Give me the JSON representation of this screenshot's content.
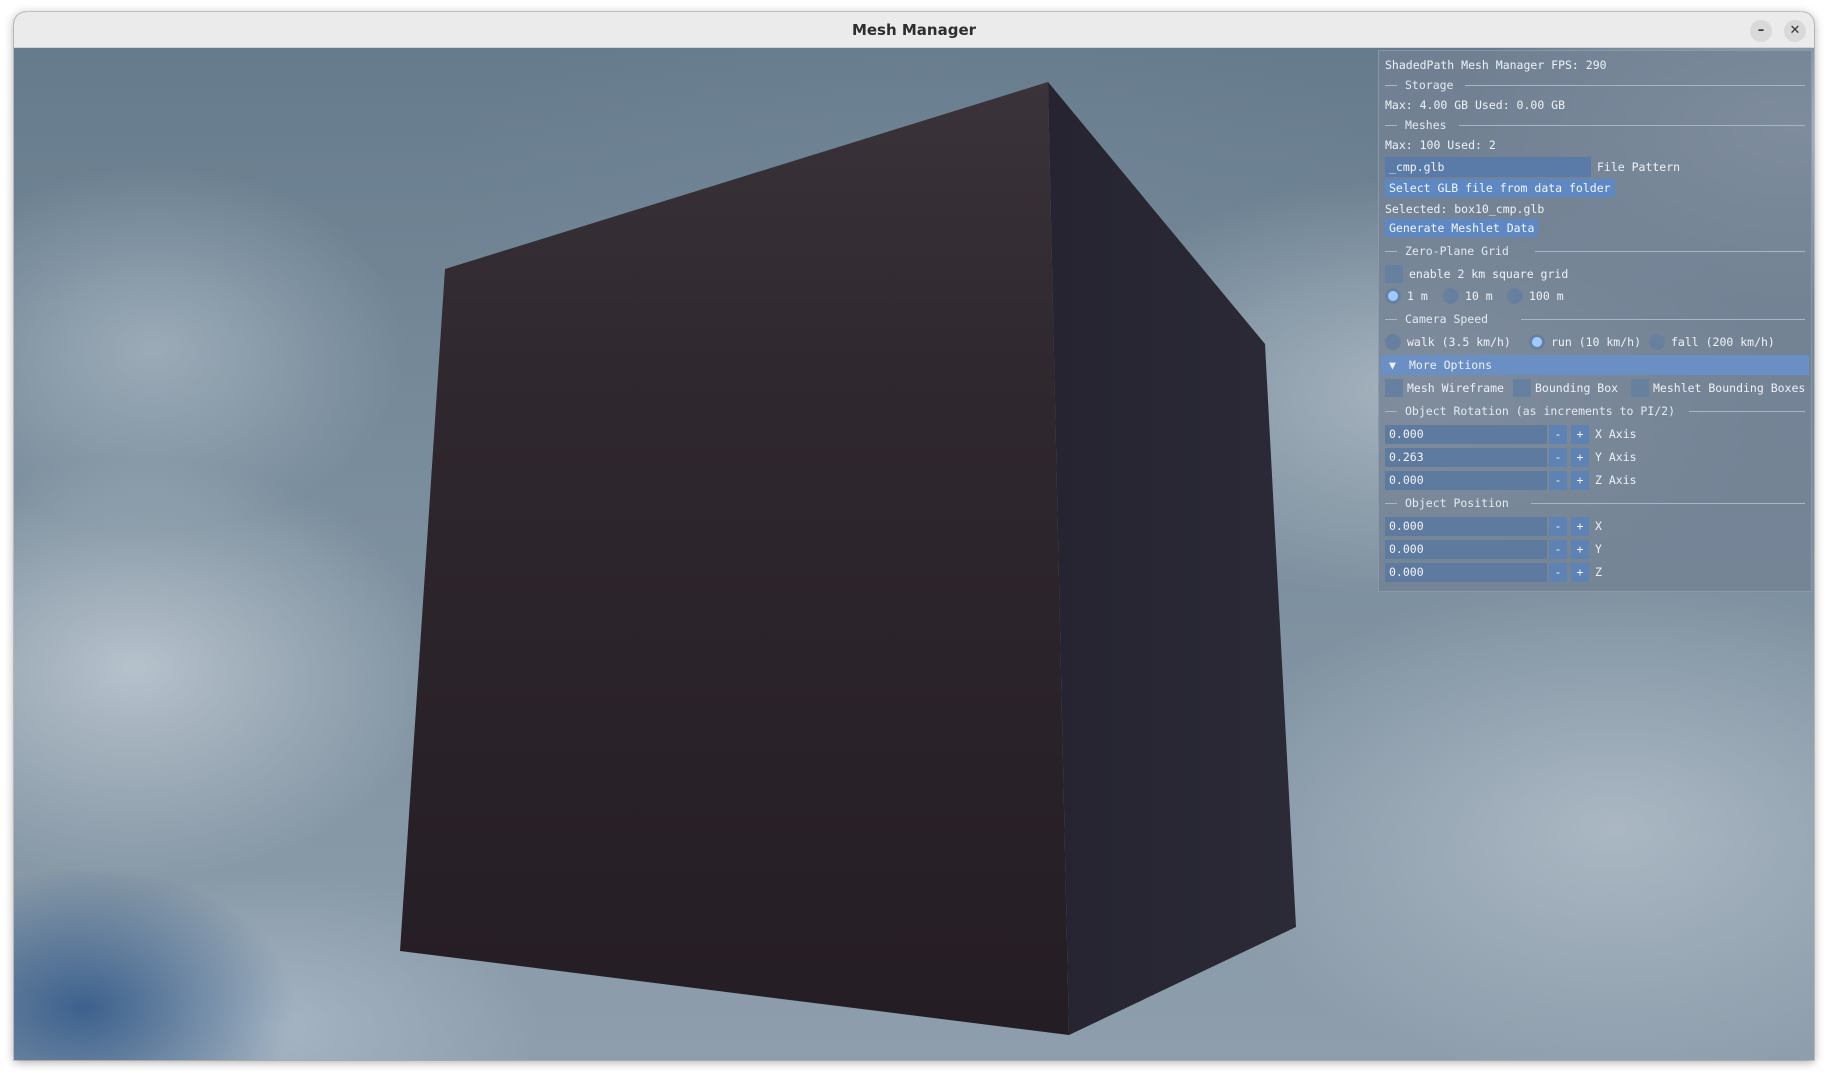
{
  "window": {
    "title": "Mesh Manager",
    "minimize_glyph": "–",
    "close_glyph": "✕"
  },
  "panel": {
    "fps_line": "ShadedPath Mesh Manager FPS: 290",
    "storage": {
      "header": "Storage",
      "info": "Max: 4.00 GB Used: 0.00 GB"
    },
    "meshes": {
      "header": "Meshes",
      "info": "Max: 100 Used: 2"
    },
    "file_pattern": {
      "value": "_cmp.glb",
      "label": "File Pattern"
    },
    "select_button": "Select GLB file from data folder",
    "selected_text": "Selected: box10_cmp.glb",
    "generate_button": "Generate Meshlet Data",
    "grid": {
      "header": "Zero-Plane Grid",
      "enable_label": "enable 2 km square grid",
      "enabled": false,
      "options": [
        "1 m",
        "10 m",
        "100 m"
      ],
      "selected": "1 m"
    },
    "camera": {
      "header": "Camera Speed",
      "options": [
        "walk (3.5 km/h)",
        "run (10 km/h)",
        "fall (200 km/h)"
      ],
      "selected": "run (10 km/h)"
    },
    "more_options": {
      "arrow": "▼",
      "label": "More Options",
      "checkboxes": [
        "Mesh Wireframe",
        "Bounding Box",
        "Meshlet Bounding Boxes"
      ]
    },
    "rotation": {
      "header": "Object Rotation (as increments to PI/2)",
      "x": {
        "value": "0.000",
        "label": "X Axis"
      },
      "y": {
        "value": "0.263",
        "label": "Y Axis"
      },
      "z": {
        "value": "0.000",
        "label": "Z Axis"
      }
    },
    "position": {
      "header": "Object Position",
      "x": {
        "value": "0.000",
        "label": "X"
      },
      "y": {
        "value": "0.000",
        "label": "Y"
      },
      "z": {
        "value": "0.000",
        "label": "Z"
      }
    },
    "minus": "-",
    "plus": "+"
  },
  "colors": {
    "cube_front": "#2c252b",
    "cube_side": "#262530",
    "panel_accent": "#5d88c4"
  }
}
